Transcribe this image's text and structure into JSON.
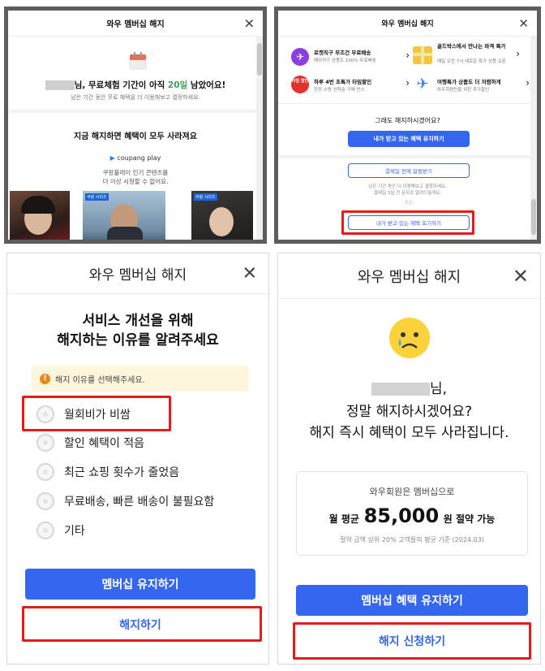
{
  "p1": {
    "title": "와우 멤버십 해지",
    "user_name": "",
    "trial_prefix": "님, 무료체험 기간이 아직 ",
    "trial_days": "20일",
    "trial_suffix": " 남았어요!",
    "trial_sub": "남은 기간 동안 무료 혜택을 더 이용해보고 결정하세요.",
    "lose_title": "지금 해지하면 혜택이 모두 사라져요",
    "brand": "coupang play",
    "play_desc1": "쿠팡플레이 인기 콘텐츠를",
    "play_desc2": "더 이상 시청할 수 없어요.",
    "series_badge_1": "쿠팡 시리즈",
    "series_badge_2": "쿠팡 시리즈"
  },
  "p2": {
    "title": "와우 멤버십 해지",
    "benefits": [
      {
        "name": "로켓직구 무조건 무료배송",
        "desc": "해외직구 상품도 100% 무료배송"
      },
      {
        "name": "골드박스에서 만나는 파격 특가",
        "desc": "매일 오전 7시 새로운 특가 상품 오픈"
      },
      {
        "name": "하루 4번 초특가 타임할인",
        "desc": "한정 수량 선착순 구매 찬스"
      },
      {
        "name": "여행특가 상품도 더 저렴하게",
        "desc": "와우회원만을 위한 추가할인"
      }
    ],
    "time_badge": "타임 할인",
    "question": "그래도 해지하시겠어요?",
    "keep_label": "내가 받고 있는 혜택 유지하기",
    "notify_label": "결제일 전에 알림받기",
    "notify_desc1": "남은 기간 동안 더 이용해보고 결정하세요.",
    "notify_desc2": "결제일 3일 전 문자로 알려드릴게요.",
    "or_label": "또는",
    "give_up_label": "내가 받고 있는 혜택 포기하기"
  },
  "p3": {
    "title": "와우 멤버십 해지",
    "heading1": "서비스 개선을 위해",
    "heading2": "해지하는 이유를 알려주세요",
    "notice": "해지 이유를 선택해주세요.",
    "reasons": [
      "월회비가 비쌈",
      "할인 혜택이 적음",
      "최근 쇼핑 횟수가 줄었음",
      "무료배송, 빠른 배송이 불필요함",
      "기타"
    ],
    "keep_label": "멤버십 유지하기",
    "cancel_label": "해지하기"
  },
  "p4": {
    "title": "와우 멤버십 해지",
    "user_suffix": "님,",
    "confirm1": "정말 해지하시겠어요?",
    "confirm2": "해지 즉시 혜택이 모두 사라집니다.",
    "saving_label": "와우회원은 멤버십으로",
    "avg_prefix": "월 평균",
    "amount": "85,000",
    "avg_suffix": "원 절약 가능",
    "footnote": "절약 금액 상위 20% 고객들의 평균 기준 (2024.03)",
    "keep_label": "멤버십 혜택 유지하기",
    "apply_label": "해지 신청하기"
  },
  "colors": {
    "accent": "#3466f0",
    "highlight": "#e21b1b",
    "trial_days": "#3aa05a"
  }
}
